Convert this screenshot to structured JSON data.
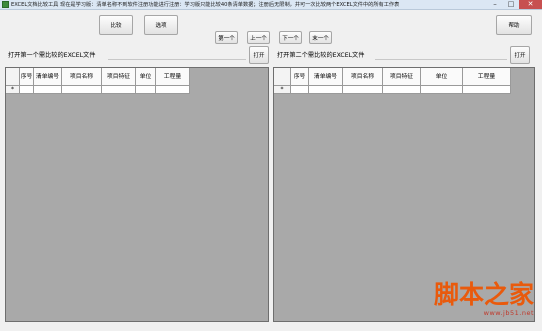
{
  "window": {
    "title": "EXCEL文档比较工具    现在是学习版：清单名称不到软件注册功能进行注册：学习版只能比较40条清单数据；注册后无限制，并可一次比较两个EXCEL文件中的所有工作表",
    "minimize": "–",
    "maximize": "□",
    "close": "✕"
  },
  "toolbar": {
    "compare": "比较",
    "options": "选项",
    "first": "第一个",
    "prev": "上一个",
    "next": "下一个",
    "last": "末一个",
    "help": "帮助"
  },
  "left_panel": {
    "file_label": "打开第一个需比较的EXCEL文件",
    "open_button": "打开",
    "columns": [
      "序号",
      "清单编号",
      "项目名称",
      "项目特征",
      "单位",
      "工程量"
    ],
    "new_row_marker": "*"
  },
  "right_panel": {
    "file_label": "打开第二个需比较的EXCEL文件",
    "open_button": "打开",
    "columns": [
      "序号",
      "清单编号",
      "项目名称",
      "项目特征",
      "单位",
      "工程量"
    ],
    "new_row_marker": "*"
  },
  "watermark": {
    "logo": "脚本之家",
    "url": "www.jb51.net"
  }
}
